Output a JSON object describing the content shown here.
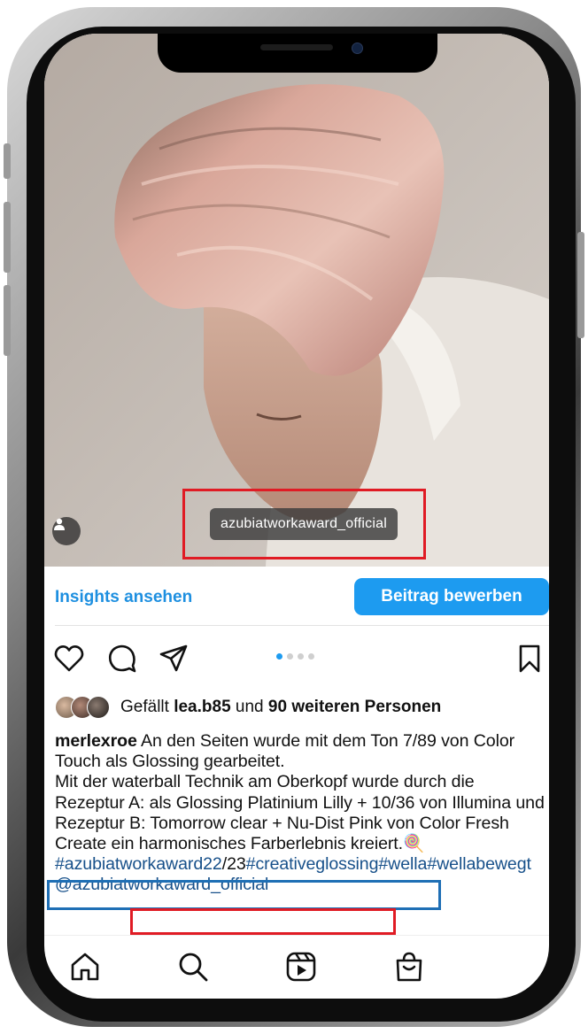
{
  "post": {
    "tagged_user": "azubiatworkaward_official",
    "insights_link": "Insights ansehen",
    "promote_button": "Beitrag bewerben",
    "carousel": {
      "count": 4,
      "active_index": 0
    },
    "likes": {
      "prefix": "Gefällt",
      "user": "lea.b85",
      "connector": "und",
      "others": "90 weiteren Personen"
    },
    "caption": {
      "author": "merlexroe",
      "line1": "An den Seiten wurde mit dem Ton 7/89 von Color Touch als Glossing gearbeitet.",
      "line2": "Mit der waterball  Technik am Oberkopf wurde durch die Rezeptur A: als Glossing Platinium Lilly + 10/36 von Illumina und Rezeptur B: Tomorrow clear + Nu-Dist Pink von Color Fresh Create ein harmonisches Farberlebnis kreiert.",
      "emoji": "🍭",
      "hashtags": {
        "tag1": "#azubiatworkaward22",
        "sep": "/23",
        "tag2": "#creativeglossing",
        "tag3": "#wella",
        "tag4": "#wellabewegt"
      },
      "mention": "@azubiatworkaward_official"
    }
  },
  "nav": {
    "items": [
      "home-icon",
      "search-icon",
      "reels-icon",
      "shop-icon"
    ]
  },
  "colors": {
    "accent": "#1d9bf0",
    "link": "#1d8fe0",
    "hashtag": "#17508a",
    "annotation_red": "#e01b24",
    "annotation_blue": "#1f6fb5"
  }
}
